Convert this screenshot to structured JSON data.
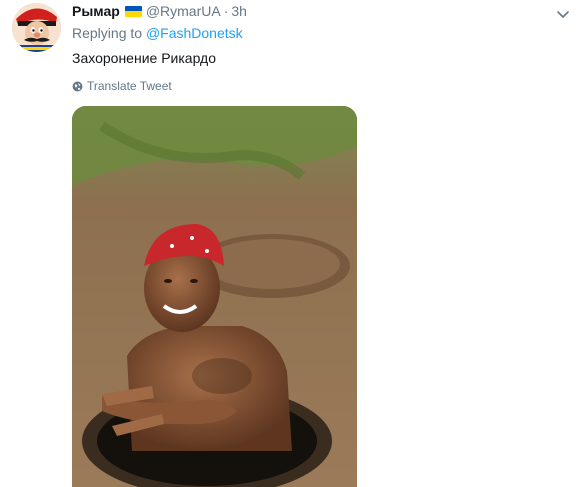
{
  "tweet": {
    "display_name": "Рымар",
    "handle": "@RymarUA",
    "separator": "·",
    "time": "3h",
    "reply_prefix": "Replying to",
    "reply_to": "@FashDonetsk",
    "text": "Захоронение Рикардо",
    "translate_label": "Translate Tweet",
    "flag_colors": [
      "#0057b7",
      "#ffd700"
    ],
    "link_color": "#1da1f2",
    "muted_color": "#657786"
  },
  "icons": {
    "caret": "chevron-down-icon",
    "translate": "globe-icon"
  },
  "media": {
    "description_icon": "photo"
  }
}
